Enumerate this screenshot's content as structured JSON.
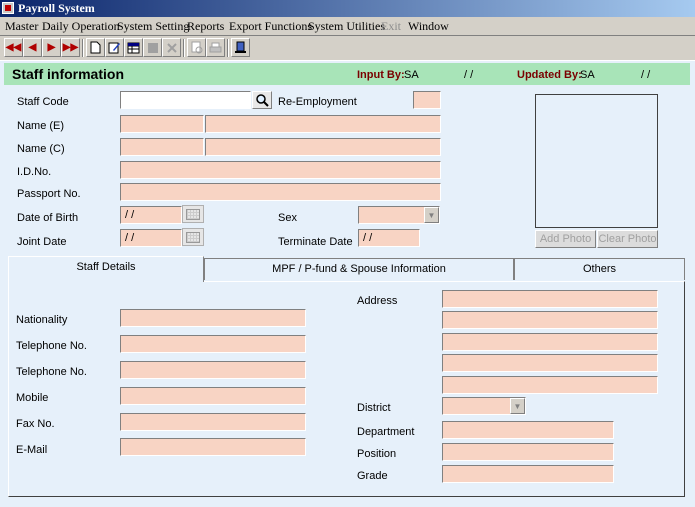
{
  "window": {
    "title": "Payroll System"
  },
  "menu": [
    "Master",
    "Daily Operation",
    "System Setting",
    "Reports",
    "Export Functions",
    "System Utilities",
    "Exit",
    "Window"
  ],
  "toolbar": {
    "first": "◀◀",
    "prev": "◀",
    "next": "▶",
    "last": "▶▶"
  },
  "header": {
    "title": "Staff information",
    "input_by_label": "Input By:",
    "input_by_value": "SA",
    "input_date": "/ /",
    "updated_by_label": "Updated By:",
    "updated_by_value": "SA",
    "updated_date": "/ /"
  },
  "form": {
    "staff_code_label": "Staff Code",
    "staff_code_value": "",
    "re_employment_label": "Re-Employment",
    "name_e_label": "Name (E)",
    "name_c_label": "Name (C)",
    "id_no_label": "I.D.No.",
    "passport_label": "Passport No.",
    "dob_label": "Date of Birth",
    "dob_value": "/ /",
    "sex_label": "Sex",
    "joint_date_label": "Joint Date",
    "joint_date_value": "/ /",
    "terminate_label": "Terminate Date",
    "terminate_value": "/ /",
    "add_photo": "Add Photo",
    "clear_photo": "Clear Photo"
  },
  "tabs": [
    "Staff Details",
    "MPF / P-fund & Spouse Information",
    "Others"
  ],
  "details": {
    "nationality": "Nationality",
    "tel1": "Telephone No.",
    "tel2": "Telephone No.",
    "mobile": "Mobile",
    "fax": "Fax No.",
    "email": "E-Mail",
    "address": "Address",
    "district": "District",
    "department": "Department",
    "position": "Position",
    "grade": "Grade"
  },
  "colors": {
    "field": "#f8d4c4",
    "panel": "#e6f0fa",
    "header": "#a8e4b8",
    "accent_label": "#7a0000"
  }
}
